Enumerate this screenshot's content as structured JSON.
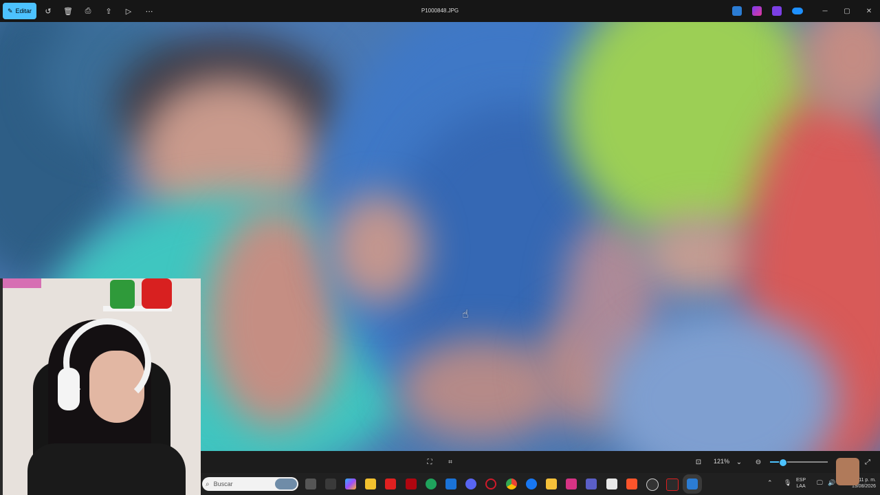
{
  "titlebar": {
    "edit_label": "Editar",
    "file_name": "P1000848.JPG",
    "icons": [
      "rotate-icon",
      "delete-icon",
      "print-icon",
      "share-icon",
      "slideshow-icon",
      "more-icon"
    ],
    "apps": [
      "photo-editor-icon",
      "clipchamp-icon",
      "video-icon",
      "onedrive-icon"
    ]
  },
  "bottombar": {
    "zoom_value": "121%",
    "zoom_fraction": 0.21
  },
  "taskbar": {
    "search_placeholder": "Buscar",
    "lang_top": "ESP",
    "lang_bottom": "LAA",
    "time": "…11 p. m.",
    "date": "13/08/2026",
    "colors": {
      "accent": "#4cc2ff",
      "taskbar": "#202020"
    }
  }
}
